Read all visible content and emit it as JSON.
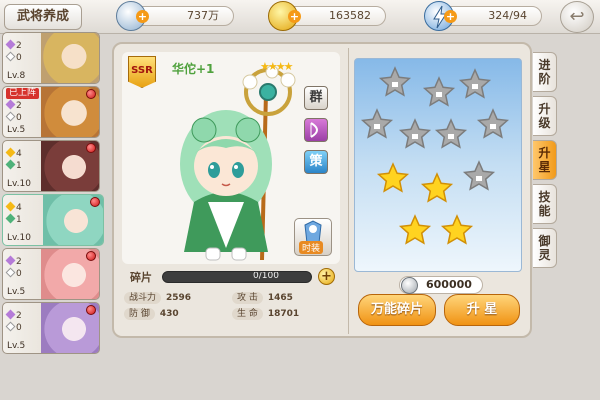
{
  "topbar": {
    "title": "武将养成",
    "silver": "737万",
    "gold": "163582",
    "stamina": "324/94",
    "silver_icon": "silver-coin-icon",
    "gold_icon": "gold-coin-icon",
    "stamina_icon": "lightning-icon"
  },
  "hero_list": [
    {
      "stars": "2",
      "gems": "0",
      "level": "Lv.8",
      "deployed": false,
      "badge": false,
      "accent": "#d8b560"
    },
    {
      "stars": "2",
      "gems": "0",
      "level": "Lv.5",
      "deployed": true,
      "deployed_label": "已上阵",
      "badge": true,
      "accent": "#d08c3c"
    },
    {
      "stars": "4",
      "gems": "1",
      "level": "Lv.10",
      "deployed": false,
      "badge": true,
      "accent": "#7a3d3a"
    },
    {
      "stars": "4",
      "gems": "1",
      "level": "Lv.10",
      "deployed": false,
      "badge": true,
      "accent": "#8fd6c1",
      "selected": true
    },
    {
      "stars": "2",
      "gems": "0",
      "level": "Lv.5",
      "deployed": false,
      "badge": true,
      "accent": "#f2a9a9"
    },
    {
      "stars": "2",
      "gems": "0",
      "level": "Lv.5",
      "deployed": false,
      "badge": true,
      "accent": "#b99ad8"
    }
  ],
  "hero": {
    "rarity": "SSR",
    "name": "华佗+1",
    "stars": "★★★★",
    "tags": [
      "群",
      "弓",
      "策"
    ],
    "fashion_label": "时装",
    "fragment_label": "碎片",
    "fragment_text": "0/100",
    "fragment_progress": 0,
    "stats": [
      {
        "key": "战斗力",
        "value": "2596"
      },
      {
        "key": "攻 击",
        "value": "1465"
      },
      {
        "key": "防 御",
        "value": "430"
      },
      {
        "key": "生 命",
        "value": "18701"
      }
    ]
  },
  "star_panel": {
    "cost": "600000",
    "universal_button": "万能碎片",
    "upgrade_button": "升 星",
    "stars": [
      {
        "lit": false
      },
      {
        "lit": false
      },
      {
        "lit": false
      },
      {
        "lit": false
      },
      {
        "lit": false
      },
      {
        "lit": false
      },
      {
        "lit": false
      },
      {
        "lit": true
      },
      {
        "lit": true
      },
      {
        "lit": false
      },
      {
        "lit": true
      },
      {
        "lit": true
      }
    ]
  },
  "right_tabs": [
    {
      "label": "进阶",
      "active": false
    },
    {
      "label": "升级",
      "active": false
    },
    {
      "label": "升星",
      "active": true
    },
    {
      "label": "技能",
      "active": false
    },
    {
      "label": "御灵",
      "active": false
    }
  ],
  "colors": {
    "accent": "#f09213",
    "panel": "#ebe6de",
    "sky": "#86b9e8"
  }
}
